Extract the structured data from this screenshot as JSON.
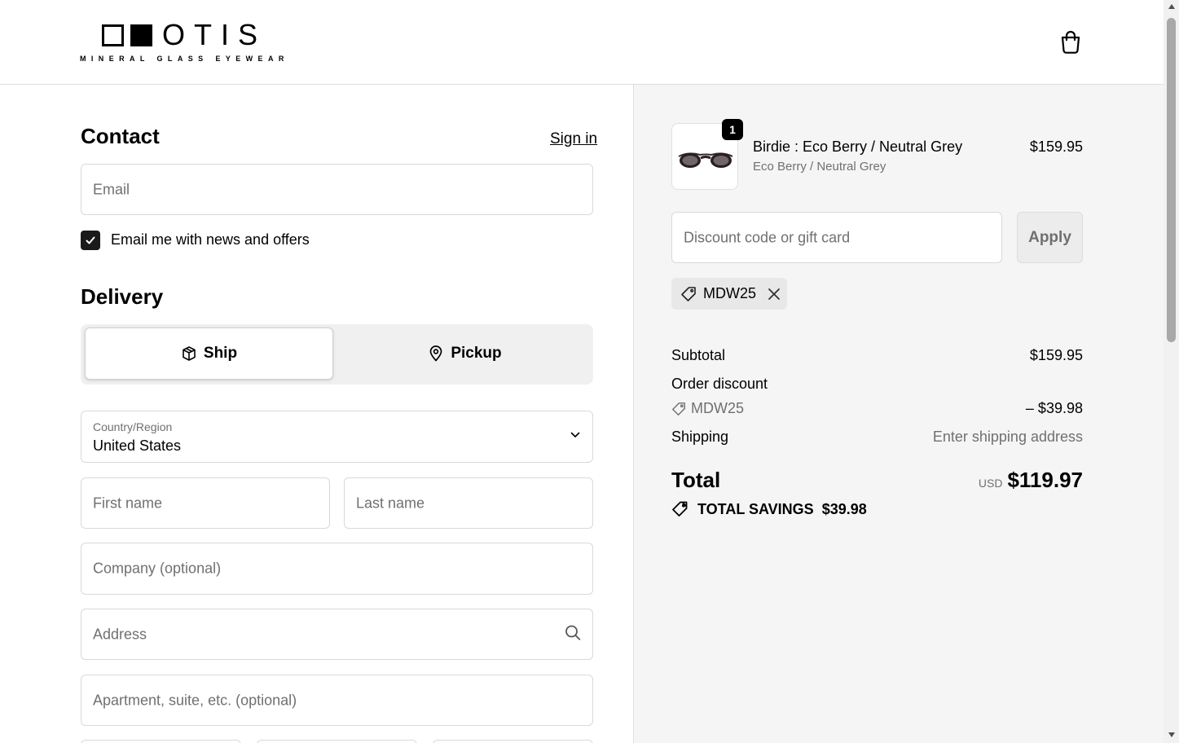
{
  "brand": {
    "wordmark": "OTIS",
    "tagline": "MINERAL GLASS EYEWEAR"
  },
  "contact": {
    "heading": "Contact",
    "sign_in": "Sign in",
    "email_placeholder": "Email",
    "newsletter_label": "Email me with news and offers",
    "newsletter_checked": true
  },
  "delivery": {
    "heading": "Delivery",
    "options": [
      {
        "label": "Ship",
        "icon": "box-icon",
        "selected": true
      },
      {
        "label": "Pickup",
        "icon": "location-pin-icon",
        "selected": false
      }
    ],
    "country_label": "Country/Region",
    "country_value": "United States",
    "first_name_placeholder": "First name",
    "last_name_placeholder": "Last name",
    "company_placeholder": "Company (optional)",
    "address_placeholder": "Address",
    "apartment_placeholder": "Apartment, suite, etc. (optional)"
  },
  "summary": {
    "item": {
      "quantity": "1",
      "name": "Birdie : Eco Berry / Neutral Grey",
      "variant": "Eco Berry / Neutral Grey",
      "price": "$159.95"
    },
    "discount_placeholder": "Discount code or gift card",
    "apply_label": "Apply",
    "applied_code": "MDW25",
    "subtotal_label": "Subtotal",
    "subtotal_value": "$159.95",
    "order_discount_label": "Order discount",
    "discount_code": "MDW25",
    "discount_value": "– $39.98",
    "shipping_label": "Shipping",
    "shipping_value": "Enter shipping address",
    "total_label": "Total",
    "currency": "USD",
    "total_value": "$119.97",
    "savings_label": "TOTAL SAVINGS",
    "savings_value": "$39.98"
  },
  "colors": {
    "primary": "#000000",
    "muted_text": "#707070",
    "summary_bg": "#f5f5f5",
    "border": "#d9d9d9"
  }
}
